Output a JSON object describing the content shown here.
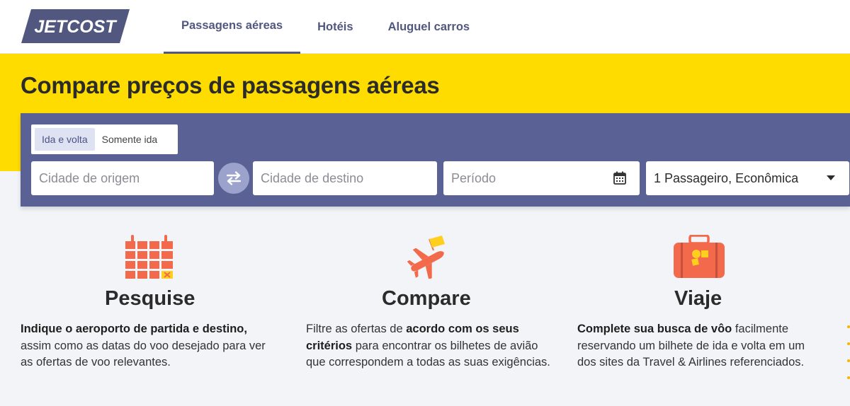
{
  "brand": {
    "logo_text": "JETCOST",
    "logo_color": "#52577f"
  },
  "nav": {
    "items": [
      {
        "label": "Passagens aéreas",
        "active": true
      },
      {
        "label": "Hotéis",
        "active": false
      },
      {
        "label": "Aluguel carros",
        "active": false
      }
    ]
  },
  "hero": {
    "title": "Compare preços de passagens aéreas",
    "background": "#ffdc00"
  },
  "search": {
    "trip_types": [
      {
        "label": "Ida e volta",
        "selected": true
      },
      {
        "label": "Somente ida",
        "selected": false
      }
    ],
    "origin_placeholder": "Cidade de origem",
    "destination_placeholder": "Cidade de destino",
    "period_placeholder": "Período",
    "passengers_value": "1 Passageiro, Econômica",
    "panel_color": "#5a6194",
    "icons": {
      "swap": "swap-arrows-icon",
      "calendar": "calendar-icon",
      "dropdown": "caret-down-icon"
    }
  },
  "features": [
    {
      "icon": "calendar-grid-icon",
      "title": "Pesquise",
      "desc_bold": "Indique o aeroporto de partida e destino,",
      "desc_rest": " assim como as datas do voo desejado para ver as ofertas de voo relevantes."
    },
    {
      "icon": "airplane-flag-icon",
      "title": "Compare",
      "desc_pre": "Filtre as ofertas de ",
      "desc_bold": "acordo com os seus critérios",
      "desc_rest": " para encontrar os bilhetes de avião que correspondem a todas as suas exigências."
    },
    {
      "icon": "suitcase-icon",
      "title": "Viaje",
      "desc_bold": "Complete sua busca de vôo",
      "desc_rest": " facilmente reservando um bilhete de ida e volta em um dos sites da Travel & Airlines referenciados."
    }
  ],
  "colors": {
    "accent_icon": "#f26a4b",
    "accent_yellow": "#ffdc00"
  }
}
